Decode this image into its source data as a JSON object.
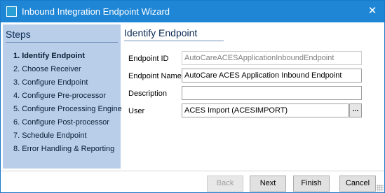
{
  "window": {
    "title": "Inbound Integration Endpoint Wizard",
    "close_glyph": "✕"
  },
  "steps": {
    "title": "Steps",
    "items": [
      {
        "label": "1. Identify Endpoint",
        "current": true
      },
      {
        "label": "2. Choose Receiver",
        "current": false
      },
      {
        "label": "3. Configure Endpoint",
        "current": false
      },
      {
        "label": "4. Configure Pre-processor",
        "current": false
      },
      {
        "label": "5. Configure Processing Engine",
        "current": false
      },
      {
        "label": "6. Configure Post-processor",
        "current": false
      },
      {
        "label": "7. Schedule Endpoint",
        "current": false
      },
      {
        "label": "8. Error Handling & Reporting",
        "current": false
      }
    ]
  },
  "content": {
    "title": "Identify Endpoint",
    "endpoint_id": {
      "label": "Endpoint ID",
      "value": "AutoCareACESApplicationInboundEndpoint"
    },
    "endpoint_name": {
      "label": "Endpoint Name",
      "value": "AutoCare ACES Application Inbound Endpoint"
    },
    "description": {
      "label": "Description",
      "value": ""
    },
    "user": {
      "label": "User",
      "value": "ACES Import (ACESIMPORT)",
      "browse_label": "..."
    }
  },
  "footer": {
    "back_label": "Back",
    "next_label": "Next",
    "finish_label": "Finish",
    "cancel_label": "Cancel"
  },
  "colors": {
    "titlebar": "#1f86d6",
    "steps_panel": "#b8cee9"
  }
}
